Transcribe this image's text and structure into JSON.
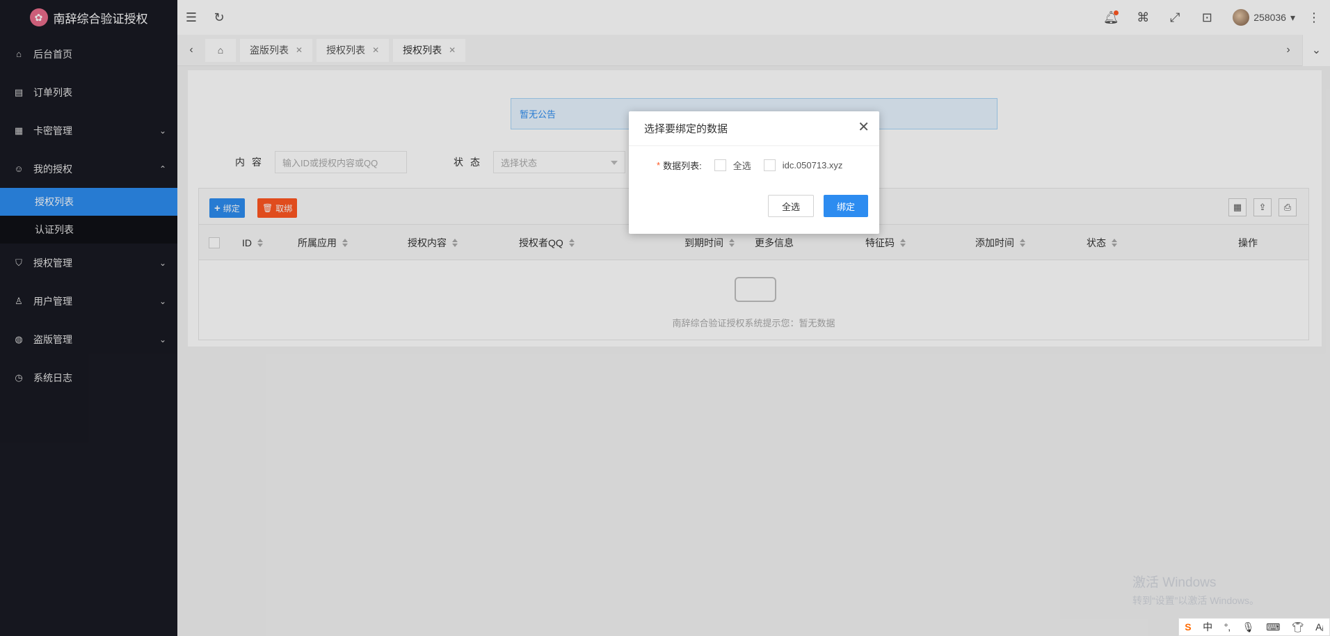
{
  "app": {
    "title": "南辞综合验证授权",
    "logo_icon": "lotus-logo-icon"
  },
  "sidebar": {
    "items": [
      {
        "label": "后台首页",
        "icon": "home-icon"
      },
      {
        "label": "订单列表",
        "icon": "file-icon"
      },
      {
        "label": "卡密管理",
        "icon": "grid-icon",
        "arrow": "⌄"
      },
      {
        "label": "我的授权",
        "icon": "smile-icon",
        "arrow": "⌃"
      },
      {
        "label": "授权管理",
        "icon": "shield-icon",
        "arrow": "⌄"
      },
      {
        "label": "用户管理",
        "icon": "user-icon",
        "arrow": "⌄"
      },
      {
        "label": "盗版管理",
        "icon": "globe-icon",
        "arrow": "⌄"
      },
      {
        "label": "系统日志",
        "icon": "clock-icon"
      }
    ],
    "submenu": [
      {
        "label": "授权列表",
        "active": true
      },
      {
        "label": "认证列表",
        "active": false
      }
    ]
  },
  "header": {
    "username": "258036"
  },
  "tabs": [
    {
      "label": "盗版列表"
    },
    {
      "label": "授权列表"
    },
    {
      "label": "授权列表",
      "active": true
    }
  ],
  "notice": "暂无公告",
  "filters": {
    "content_label": "内容",
    "content_placeholder": "输入ID或授权内容或QQ",
    "status_label": "状态",
    "status_placeholder": "选择状态"
  },
  "toolbar": {
    "bind_label": "绑定",
    "unbind_label": "取绑"
  },
  "table": {
    "columns": [
      "ID",
      "所属应用",
      "授权内容",
      "授权者QQ",
      "到期时间",
      "更多信息",
      "特征码",
      "添加时间",
      "状态",
      "操作"
    ],
    "empty_text": "南辞综合验证授权系统提示您：暂无数据"
  },
  "modal": {
    "title": "选择要绑定的数据",
    "field_label": "数据列表:",
    "options": [
      "全选",
      "idc.050713.xyz"
    ],
    "select_all_button": "全选",
    "confirm_button": "绑定"
  },
  "watermark": {
    "title": "激活 Windows",
    "subtitle": "转到“设置”以激活 Windows。"
  },
  "ime": {
    "mode": "中"
  },
  "colors": {
    "primary": "#2d8cf0",
    "danger": "#ff5722",
    "sidebar_bg": "#191a23"
  }
}
